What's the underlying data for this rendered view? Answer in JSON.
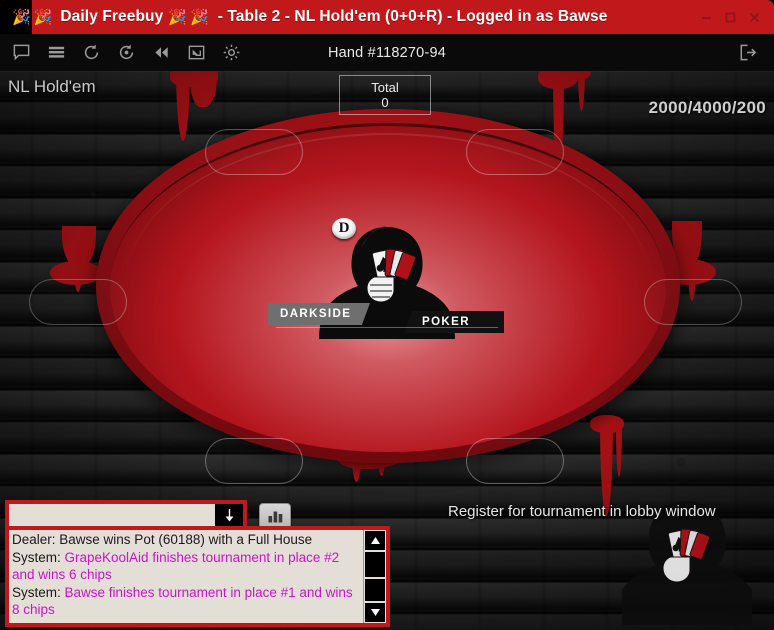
{
  "window": {
    "title_prefix": "Daily Freebuy",
    "title_suffix": "- Table 2 - NL Hold'em (0+0+R) - Logged in as Bawse",
    "party_icon": "🎉",
    "accent_red": "#c1191b",
    "controls": {
      "minimize_name": "minimize-button",
      "maximize_name": "maximize-button",
      "close_name": "close-button"
    }
  },
  "toolbar": {
    "icons": [
      {
        "name": "chat-icon",
        "label": "Chat"
      },
      {
        "name": "menu-icon",
        "label": "Menu"
      },
      {
        "name": "refresh-icon",
        "label": "Refresh"
      },
      {
        "name": "sit-out-icon",
        "label": "Sit Out"
      },
      {
        "name": "rewind-icon",
        "label": "Previous Hand"
      },
      {
        "name": "resize-icon",
        "label": "Resize Table"
      },
      {
        "name": "settings-icon",
        "label": "Settings"
      }
    ],
    "hand_id": "Hand #118270-94",
    "exit_icon": "exit-icon"
  },
  "table": {
    "game_type": "NL Hold'em",
    "blinds": "2000/4000/200",
    "pot": {
      "label": "Total",
      "value": "0"
    },
    "dealer_button": "D",
    "logo": {
      "left_word": "DARKSIDE",
      "right_word": "POKER"
    },
    "seats": [
      {
        "name": "seat-1",
        "occupied": false
      },
      {
        "name": "seat-2",
        "occupied": false
      },
      {
        "name": "seat-3",
        "occupied": false
      },
      {
        "name": "seat-4",
        "occupied": false
      },
      {
        "name": "seat-5",
        "occupied": false
      },
      {
        "name": "seat-6",
        "occupied": false
      }
    ],
    "register_message": "Register for tournament in lobby window"
  },
  "chat": {
    "input_value": "",
    "input_placeholder": "",
    "dropdown_glyph": "↓",
    "stats_icon": "bar-chart-icon",
    "lines": [
      {
        "source": "Dealer:",
        "text": " Bawse wins Pot (60188) with a Full House",
        "type": "dealer"
      },
      {
        "source": "System:",
        "text": " GrapeKoolAid finishes tournament in place #2 and wins 6 chips",
        "type": "system"
      },
      {
        "source": "System:",
        "text": " Bawse finishes tournament in place #1 and wins 8 chips",
        "type": "system"
      }
    ],
    "system_color": "#c815c8"
  }
}
